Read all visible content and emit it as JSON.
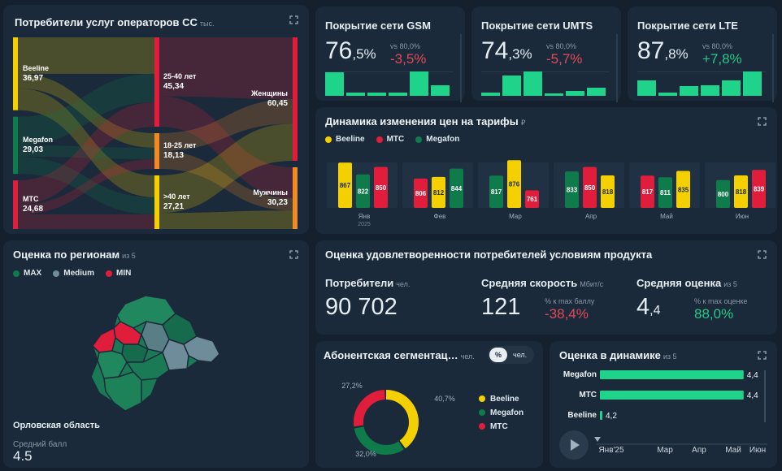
{
  "consumers": {
    "title": "Потребители услуг операторов СС",
    "unit": "тыс.",
    "operators": [
      {
        "name": "Beeline",
        "value": "36,97"
      },
      {
        "name": "Megafon",
        "value": "29,03"
      },
      {
        "name": "MTC",
        "value": "24,68"
      }
    ],
    "ages": [
      {
        "name": "25-40 лет",
        "value": "45,34"
      },
      {
        "name": "18-25 лет",
        "value": "18,13"
      },
      {
        "name": ">40 лет",
        "value": "27,21"
      }
    ],
    "genders": [
      {
        "name": "Женщины",
        "value": "60,45"
      },
      {
        "name": "Мужчины",
        "value": "30,23"
      }
    ]
  },
  "coverage": [
    {
      "title": "Покрытие сети GSM",
      "int": "76",
      "frac": ",5%",
      "vs": "vs 80,0%",
      "delta": "-3,5%",
      "delta_color": "#e24a5a",
      "bars": [
        0.9,
        0.13,
        0.13,
        0.13,
        0.93,
        0.42
      ]
    },
    {
      "title": "Покрытие сети UMTS",
      "int": "74",
      "frac": ",3%",
      "vs": "vs 80,0%",
      "delta": "-5,7%",
      "delta_color": "#e24a5a",
      "bars": [
        0.13,
        0.78,
        0.95,
        0.1,
        0.2,
        0.3
      ]
    },
    {
      "title": "Покрытие сети LTE",
      "int": "87",
      "frac": ",8%",
      "vs": "vs 80,0%",
      "delta": "+7,8%",
      "delta_color": "#27c98a",
      "bars": [
        0.6,
        0.13,
        0.38,
        0.42,
        0.58,
        0.95
      ]
    }
  ],
  "tariffs": {
    "title": "Динамика изменения цен на тарифы",
    "unit": "₽",
    "legend": [
      {
        "name": "Beeline",
        "color": "#f5d000"
      },
      {
        "name": "MTC",
        "color": "#e01e3c"
      },
      {
        "name": "Megafon",
        "color": "#0f7a4a"
      }
    ],
    "year_label": "2025",
    "months": [
      {
        "label": "Янв",
        "bars": [
          {
            "op": "Beeline",
            "v": 867
          },
          {
            "op": "Megafon",
            "v": 822
          },
          {
            "op": "MTC",
            "v": 850
          }
        ]
      },
      {
        "label": "Фев",
        "bars": [
          {
            "op": "MTC",
            "v": 806
          },
          {
            "op": "Beeline",
            "v": 812
          },
          {
            "op": "Megafon",
            "v": 844
          }
        ]
      },
      {
        "label": "Мар",
        "bars": [
          {
            "op": "Megafon",
            "v": 817
          },
          {
            "op": "Beeline",
            "v": 876
          },
          {
            "op": "MTC",
            "v": 761
          }
        ]
      },
      {
        "label": "Апр",
        "bars": [
          {
            "op": "Megafon",
            "v": 833
          },
          {
            "op": "MTC",
            "v": 850
          },
          {
            "op": "Beeline",
            "v": 818
          }
        ]
      },
      {
        "label": "Май",
        "bars": [
          {
            "op": "MTC",
            "v": 817
          },
          {
            "op": "Megafon",
            "v": 811
          },
          {
            "op": "Beeline",
            "v": 835
          }
        ]
      },
      {
        "label": "Июн",
        "bars": [
          {
            "op": "Megafon",
            "v": 800
          },
          {
            "op": "Beeline",
            "v": 818
          },
          {
            "op": "MTC",
            "v": 839
          }
        ]
      }
    ]
  },
  "regions": {
    "title": "Оценка по регионам",
    "unit": "из 5",
    "legend": [
      {
        "name": "MAX",
        "color": "#0f7a4a"
      },
      {
        "name": "Medium",
        "color": "#6f8c9a"
      },
      {
        "name": "MIN",
        "color": "#e01e3c"
      }
    ],
    "region_name": "Орловская область",
    "score_label": "Средний балл",
    "score": "4.5"
  },
  "satisfaction": {
    "title": "Оценка удовлетворенности потребителей условиям продукта",
    "consumers_label": "Потребители",
    "consumers_unit": "чел.",
    "consumers_value": "90 702",
    "speed_label": "Средняя скорость",
    "speed_unit": "Мбит/с",
    "speed_value": "121",
    "speed_note": "% к max баллу",
    "speed_delta": "-38,4%",
    "score_label": "Средняя оценка",
    "score_unit": "из 5",
    "score_int": "4",
    "score_frac": ",4",
    "score_note": "% к max оценке",
    "score_delta": "88,0%"
  },
  "segmentation": {
    "title": "Абонентская сегментац…",
    "unit": "чел.",
    "toggle": [
      "%",
      "чел."
    ],
    "slices": [
      {
        "name": "Beeline",
        "value": 40.7,
        "label": "40,7%",
        "color": "#f5d000"
      },
      {
        "name": "Megafon",
        "value": 32.0,
        "label": "32,0%",
        "color": "#0f7a4a"
      },
      {
        "name": "MTC",
        "value": 27.2,
        "label": "27,2%",
        "color": "#e01e3c"
      }
    ]
  },
  "rating": {
    "title": "Оценка в динамике",
    "unit": "из 5",
    "bars": [
      {
        "name": "Megafon",
        "value": 4.4,
        "label": "4,4"
      },
      {
        "name": "MTC",
        "value": 4.4,
        "label": "4,4"
      },
      {
        "name": "Beeline",
        "value": 4.2,
        "label": "4,2"
      }
    ],
    "timeline": [
      "Янв'25",
      "Мар",
      "Апр",
      "Май",
      "Июн"
    ]
  }
}
